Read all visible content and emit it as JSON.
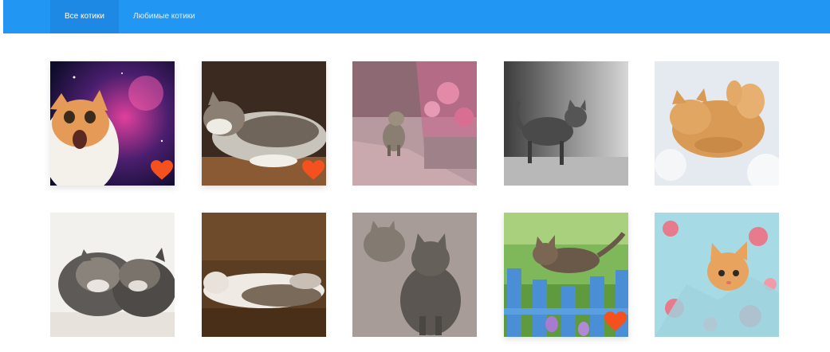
{
  "nav": {
    "tabs": [
      {
        "label": "Все котики",
        "active": true
      },
      {
        "label": "Любимые котики",
        "active": false
      }
    ]
  },
  "cards": [
    {
      "name": "space-cat",
      "favorite": true
    },
    {
      "name": "sleeping-tabby-cat",
      "favorite": true
    },
    {
      "name": "kitten-on-path",
      "favorite": false
    },
    {
      "name": "black-white-cat",
      "favorite": false
    },
    {
      "name": "ginger-cat-in-snow",
      "favorite": false
    },
    {
      "name": "sleeping-kittens",
      "favorite": false
    },
    {
      "name": "stretching-cat",
      "favorite": false
    },
    {
      "name": "gray-cats-on-gravel",
      "favorite": false
    },
    {
      "name": "kitten-on-fence",
      "favorite": true
    },
    {
      "name": "ginger-kitten-in-blanket",
      "favorite": false
    }
  ],
  "colors": {
    "navbar": "#2196f3",
    "active_tab": "#1e88e5",
    "heart": "#f4511e"
  },
  "icons": {
    "favorite": "heart-icon"
  }
}
